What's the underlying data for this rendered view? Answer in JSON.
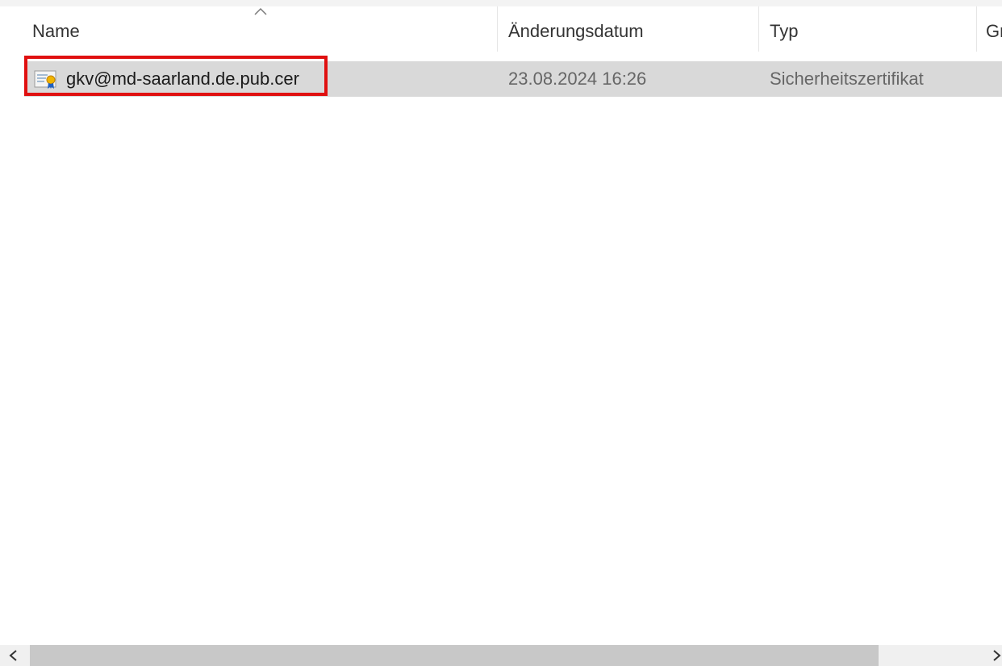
{
  "header": {
    "columns": [
      {
        "label": "Name",
        "sorted": true
      },
      {
        "label": "Änderungsdatum"
      },
      {
        "label": "Typ"
      },
      {
        "label": "Gr"
      }
    ]
  },
  "files": [
    {
      "name": "gkv@md-saarland.de.pub.cer",
      "modified": "23.08.2024 16:26",
      "type": "Sicherheitszertifikat",
      "icon": "certificate-icon",
      "selected": true,
      "highlighted": true
    }
  ],
  "colors": {
    "selection": "#d9d9d9",
    "highlight_border": "#e01010",
    "scroll_thumb": "#c8c8c8"
  }
}
